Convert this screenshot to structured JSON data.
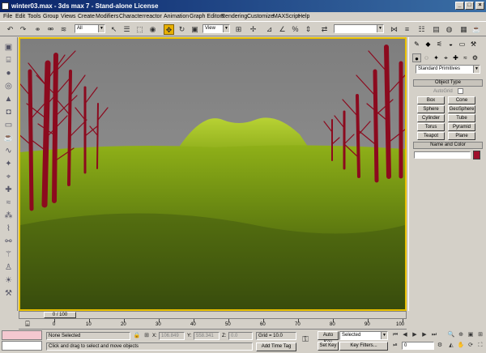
{
  "window": {
    "title": "winter03.max - 3ds max 7 - Stand-alone License",
    "min": "_",
    "max": "□",
    "close": "×"
  },
  "menu": [
    "File",
    "Edit",
    "Tools",
    "Group",
    "Views",
    "Create",
    "Modifiers",
    "Character",
    "reactor",
    "Animation",
    "Graph Editors",
    "Rendering",
    "Customize",
    "MAXScript",
    "Help"
  ],
  "toolbar": {
    "selection_filter": "All",
    "ref_coord": "View",
    "named_sets": ""
  },
  "command_panel": {
    "category": "Standard Primitives",
    "object_type_title": "Object Type",
    "autogrid": "AutoGrid",
    "primitives": [
      "Box",
      "Cone",
      "Sphere",
      "GeoSphere",
      "Cylinder",
      "Tube",
      "Torus",
      "Pyramid",
      "Teapot",
      "Plane"
    ],
    "name_color_title": "Name and Color",
    "name_value": "",
    "color": "#a0102c"
  },
  "timeline": {
    "slider": "0 / 100",
    "ticks": [
      "0",
      "10",
      "20",
      "30",
      "40",
      "50",
      "60",
      "70",
      "80",
      "90",
      "100"
    ]
  },
  "status": {
    "selection": "None Selected",
    "prompt": "Click and drag to select and move objects",
    "x_label": "X:",
    "x": "106.849",
    "y_label": "Y:",
    "y": "558.341",
    "z_label": "Z:",
    "z": "0.0",
    "grid": "Grid = 10.0",
    "add_time_tag": "Add Time Tag",
    "auto_key": "Auto Key",
    "set_key": "Set Key",
    "key_mode": "Selected",
    "key_filters": "Key Filters...",
    "frame": "0"
  }
}
